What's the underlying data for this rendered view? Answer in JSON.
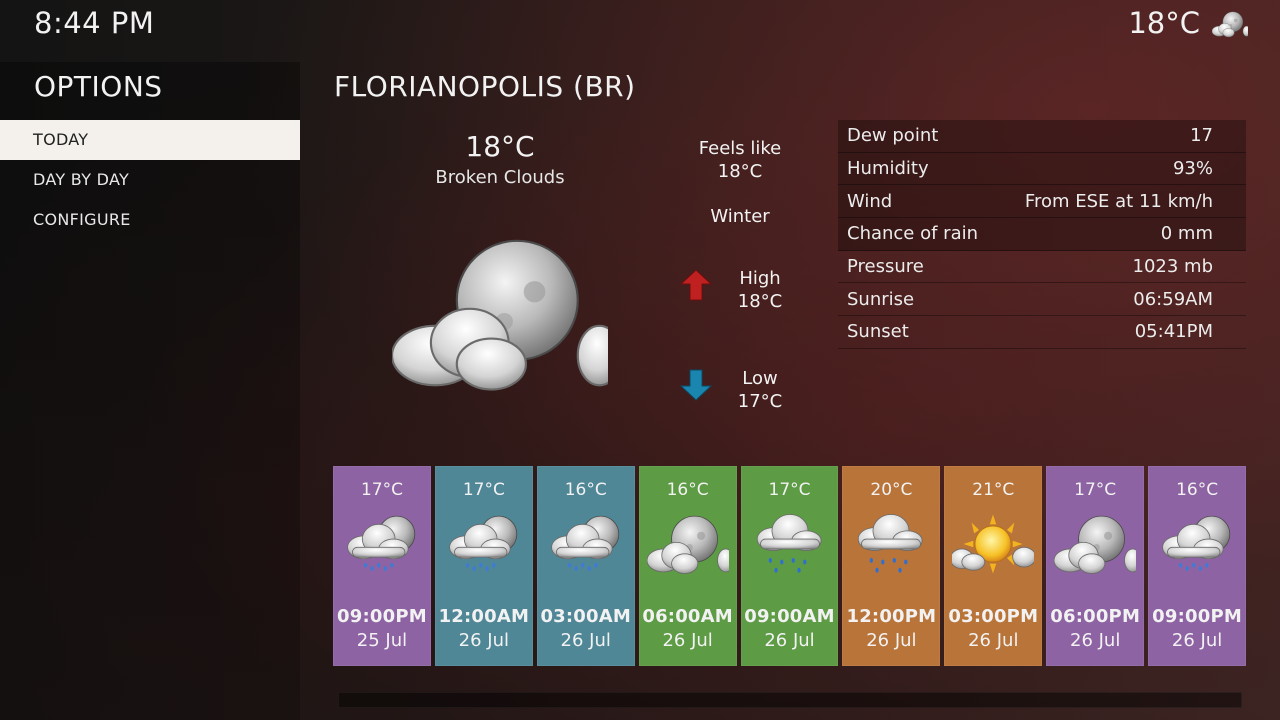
{
  "header": {
    "time": "8:44 PM",
    "temperature": "18°C",
    "weather_icon": "partly-cloudy-night-icon"
  },
  "sidebar": {
    "title": "OPTIONS",
    "items": [
      {
        "label": "TODAY",
        "active": true
      },
      {
        "label": "DAY BY DAY",
        "active": false
      },
      {
        "label": "CONFIGURE",
        "active": false
      }
    ]
  },
  "location": "FLORIANOPOLIS (BR)",
  "current": {
    "temperature": "18°C",
    "condition": "Broken Clouds",
    "icon": "moon-clouds-icon",
    "feels_like_label": "Feels like",
    "feels_like_value": "18°C",
    "season": "Winter",
    "high_label": "High",
    "high_value": "18°C",
    "low_label": "Low",
    "low_value": "17°C"
  },
  "details": [
    {
      "label": "Dew point",
      "value": "17"
    },
    {
      "label": "Humidity",
      "value": "93%"
    },
    {
      "label": "Wind",
      "value": "From ESE at 11 km/h"
    },
    {
      "label": "Chance of rain",
      "value": "0 mm"
    },
    {
      "label": "Pressure",
      "value": "1023 mb"
    },
    {
      "label": "Sunrise",
      "value": "06:59AM"
    },
    {
      "label": "Sunset",
      "value": "05:41PM"
    }
  ],
  "colors": {
    "purple": "#8e63a3",
    "teal": "#4f8797",
    "green": "#5d9b45",
    "orange": "#b9743a",
    "arrow_up": "#c0201f",
    "arrow_down": "#1a86b0"
  },
  "forecast": [
    {
      "temp": "17°C",
      "time": "09:00PM",
      "date": "25 Jul",
      "color": "#8e63a3",
      "icon": "rain-night-icon"
    },
    {
      "temp": "17°C",
      "time": "12:00AM",
      "date": "26 Jul",
      "color": "#4f8797",
      "icon": "rain-night-icon"
    },
    {
      "temp": "16°C",
      "time": "03:00AM",
      "date": "26 Jul",
      "color": "#4f8797",
      "icon": "rain-night-icon"
    },
    {
      "temp": "16°C",
      "time": "06:00AM",
      "date": "26 Jul",
      "color": "#5d9b45",
      "icon": "moon-clouds-icon"
    },
    {
      "temp": "17°C",
      "time": "09:00AM",
      "date": "26 Jul",
      "color": "#5d9b45",
      "icon": "rain-icon"
    },
    {
      "temp": "20°C",
      "time": "12:00PM",
      "date": "26 Jul",
      "color": "#b9743a",
      "icon": "rain-icon"
    },
    {
      "temp": "21°C",
      "time": "03:00PM",
      "date": "26 Jul",
      "color": "#b9743a",
      "icon": "sun-clouds-icon"
    },
    {
      "temp": "17°C",
      "time": "06:00PM",
      "date": "26 Jul",
      "color": "#8e63a3",
      "icon": "moon-clouds-icon"
    },
    {
      "temp": "16°C",
      "time": "09:00PM",
      "date": "26 Jul",
      "color": "#8e63a3",
      "icon": "rain-night-icon"
    }
  ]
}
